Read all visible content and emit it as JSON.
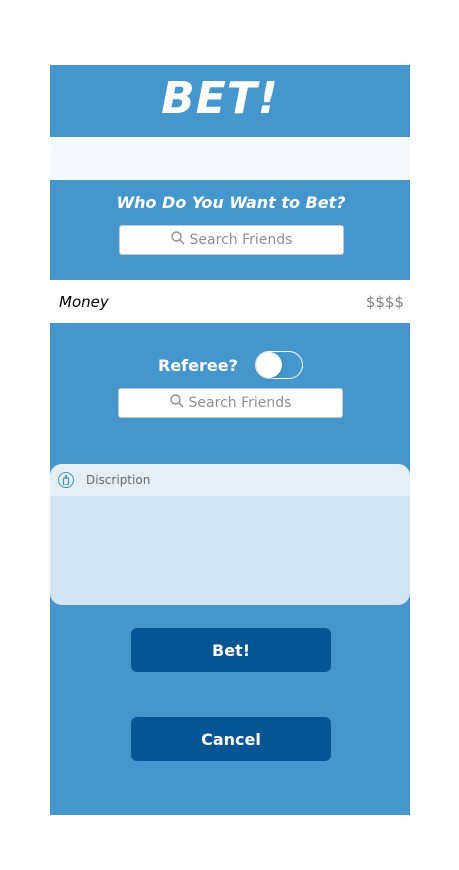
{
  "header": {
    "title": "BET!"
  },
  "opponent": {
    "prompt": "Who Do You Want to Bet?",
    "search_placeholder": "Search Friends"
  },
  "money": {
    "label": "Money",
    "value": "$$$$"
  },
  "referee": {
    "label": "Referee?",
    "toggle_on": false,
    "search_placeholder": "Search Friends"
  },
  "description": {
    "label": "Discription",
    "value": ""
  },
  "actions": {
    "bet_label": "Bet!",
    "cancel_label": "Cancel"
  },
  "colors": {
    "background": "#4596cd",
    "button": "#075595",
    "description_area": "#d2e5f2"
  }
}
